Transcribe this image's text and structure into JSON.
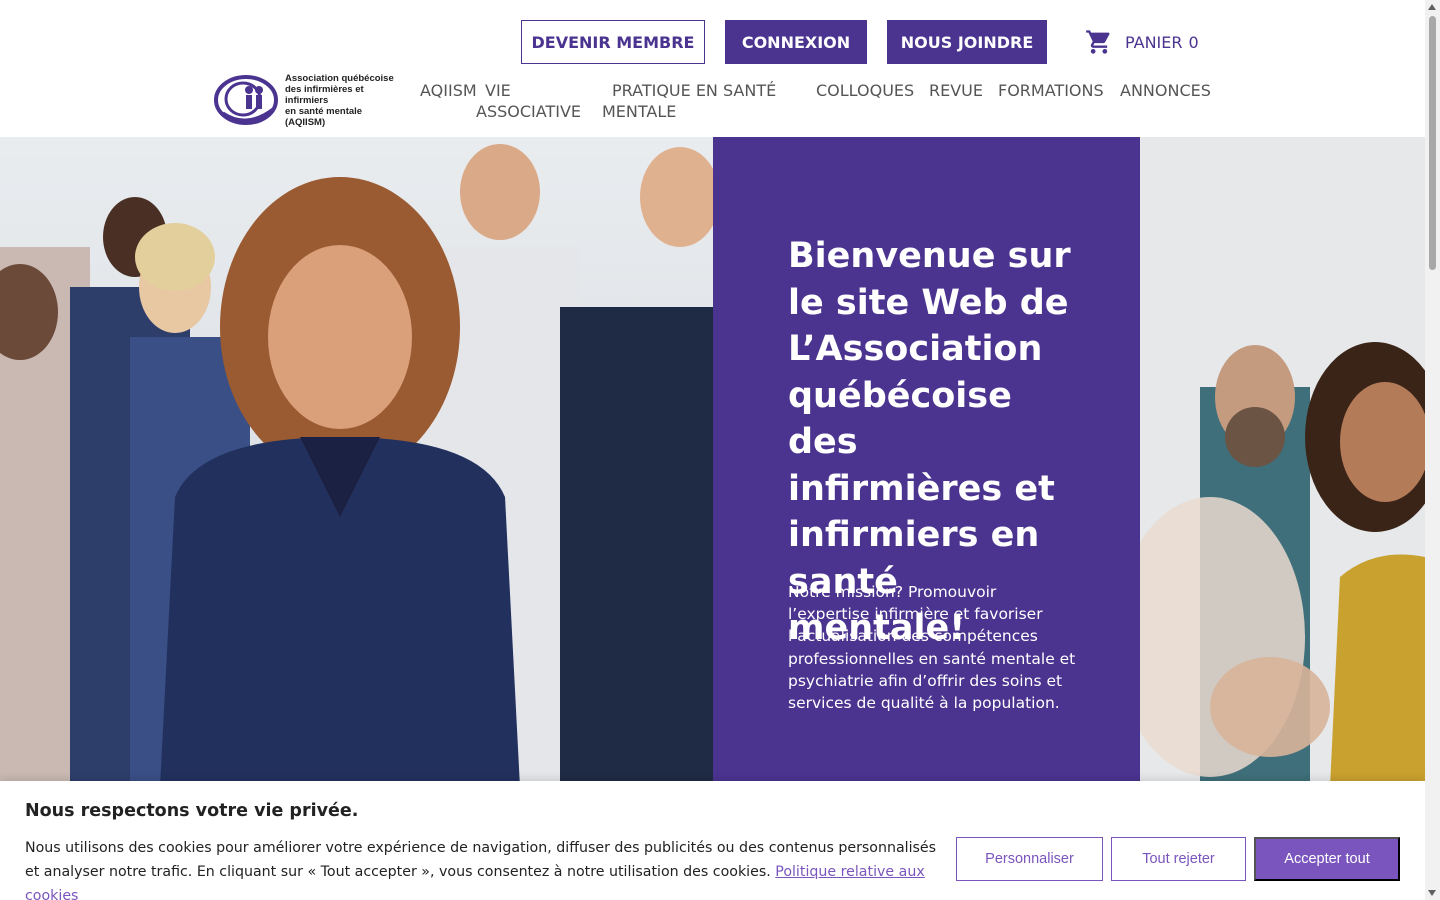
{
  "header": {
    "devenir_membre": "DEVENIR MEMBRE",
    "connexion": "CONNEXION",
    "nous_joindre": "NOUS JOINDRE",
    "cart_icon": "shopping-cart-icon",
    "cart_label": "PANIER",
    "cart_count": "0"
  },
  "logo": {
    "line1": "Association québécoise",
    "line2": "des infirmières et infirmiers",
    "line3": "en santé mentale",
    "line4": "(AQIISM)"
  },
  "nav": {
    "aqiism": "AQIISM",
    "vie_1": "VIE",
    "vie_2": "ASSOCIATIVE",
    "pratique_1": "PRATIQUE EN SANTÉ",
    "pratique_2": "MENTALE",
    "colloques": "COLLOQUES",
    "revue": "REVUE",
    "formations": "FORMATIONS",
    "annonces": "ANNONCES"
  },
  "hero": {
    "title": "Bienvenue sur le site Web de L’Association québécoise des infirmières et infirmiers en santé mentale!",
    "mission": "Notre mission? Promouvoir l’expertise infirmière et favoriser l’actualisation des compétences professionnelles en santé mentale et psychiatrie afin d’offrir des soins et services de qualité à la population."
  },
  "cookie": {
    "title": "Nous respectons votre vie privée.",
    "text": "Nous utilisons des cookies pour améliorer votre expérience de navigation, diffuser des publicités ou des contenus personnalisés et analyser notre trafic. En cliquant sur « Tout accepter », vous consentez à notre utilisation des cookies. ",
    "policy_link": "Politique relative aux cookies",
    "personnaliser": "Personnaliser",
    "tout_rejeter": "Tout rejeter",
    "accepter_tout": "Accepter tout"
  },
  "colors": {
    "brand_purple": "#4b3390",
    "cookie_accent": "#7a55bd"
  }
}
